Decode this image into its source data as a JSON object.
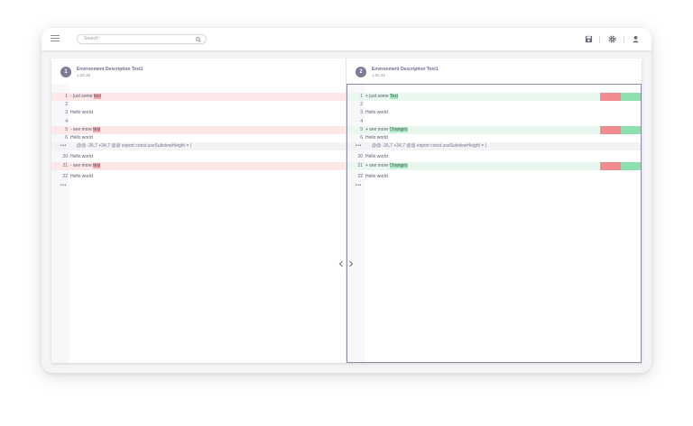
{
  "toolbar": {
    "search_placeholder": "Search",
    "icons": [
      "menu-icon",
      "search-icon",
      "save-icon",
      "settings-icon",
      "user-icon"
    ]
  },
  "panes": [
    {
      "index": "1",
      "title": "Environment Description Test1",
      "version": "1.00.30",
      "lines": [
        {
          "kind": "del",
          "ln": "1",
          "prefix": "- just some ",
          "hl": "text",
          "suffix": ""
        },
        {
          "kind": "plain",
          "ln": "2",
          "prefix": "",
          "hl": "",
          "suffix": ""
        },
        {
          "kind": "plain",
          "ln": "3",
          "prefix": "Hello world",
          "hl": "",
          "suffix": ""
        },
        {
          "kind": "plain",
          "ln": "4",
          "prefix": "",
          "hl": "",
          "suffix": ""
        },
        {
          "kind": "del",
          "ln": "5",
          "prefix": "- see more ",
          "hl": "text",
          "suffix": ""
        },
        {
          "kind": "plain",
          "ln": "6",
          "prefix": "Hello world",
          "hl": "",
          "suffix": ""
        },
        {
          "kind": "hunk",
          "ln": "•••",
          "prefix": "@@ -35,7 +34,7 @@ export const useSubviewHeight = (",
          "hl": "",
          "suffix": ""
        },
        {
          "kind": "plain",
          "ln": "20",
          "prefix": "Hello world",
          "hl": "",
          "suffix": ""
        },
        {
          "kind": "del",
          "ln": "21",
          "prefix": "- see more ",
          "hl": "text",
          "suffix": ""
        },
        {
          "kind": "plain",
          "ln": "22",
          "prefix": "Hello world",
          "hl": "",
          "suffix": ""
        },
        {
          "kind": "more",
          "ln": "•••",
          "prefix": "",
          "hl": "",
          "suffix": ""
        }
      ]
    },
    {
      "index": "2",
      "title": "Environment Description Test1",
      "version": "1.00.31",
      "lines": [
        {
          "kind": "add",
          "ln": "1",
          "prefix": "+ just some ",
          "hl": "Text",
          "suffix": ""
        },
        {
          "kind": "plain",
          "ln": "2",
          "prefix": "",
          "hl": "",
          "suffix": ""
        },
        {
          "kind": "plain",
          "ln": "3",
          "prefix": "Hello world",
          "hl": "",
          "suffix": ""
        },
        {
          "kind": "plain",
          "ln": "4",
          "prefix": "",
          "hl": "",
          "suffix": ""
        },
        {
          "kind": "add",
          "ln": "5",
          "prefix": "+ see more ",
          "hl": "Changes",
          "suffix": ""
        },
        {
          "kind": "plain",
          "ln": "6",
          "prefix": "Hello world",
          "hl": "",
          "suffix": ""
        },
        {
          "kind": "hunk",
          "ln": "•••",
          "prefix": "@@ -35,7 +34,7 @@ export const useSubviewHeight = (",
          "hl": "",
          "suffix": ""
        },
        {
          "kind": "plain",
          "ln": "20",
          "prefix": "Hello world",
          "hl": "",
          "suffix": ""
        },
        {
          "kind": "add",
          "ln": "21",
          "prefix": "+ see more ",
          "hl": "Changes",
          "suffix": ""
        },
        {
          "kind": "plain",
          "ln": "22",
          "prefix": "Hello world",
          "hl": "",
          "suffix": ""
        },
        {
          "kind": "more",
          "ln": "•••",
          "prefix": "",
          "hl": "",
          "suffix": ""
        }
      ]
    }
  ],
  "colors": {
    "deleted_bg": "#fde8e9",
    "added_bg": "#e8f8ee",
    "deleted_highlight": "#f6a5a8",
    "added_highlight": "#a8e8c2",
    "accent": "#7d7b95"
  }
}
